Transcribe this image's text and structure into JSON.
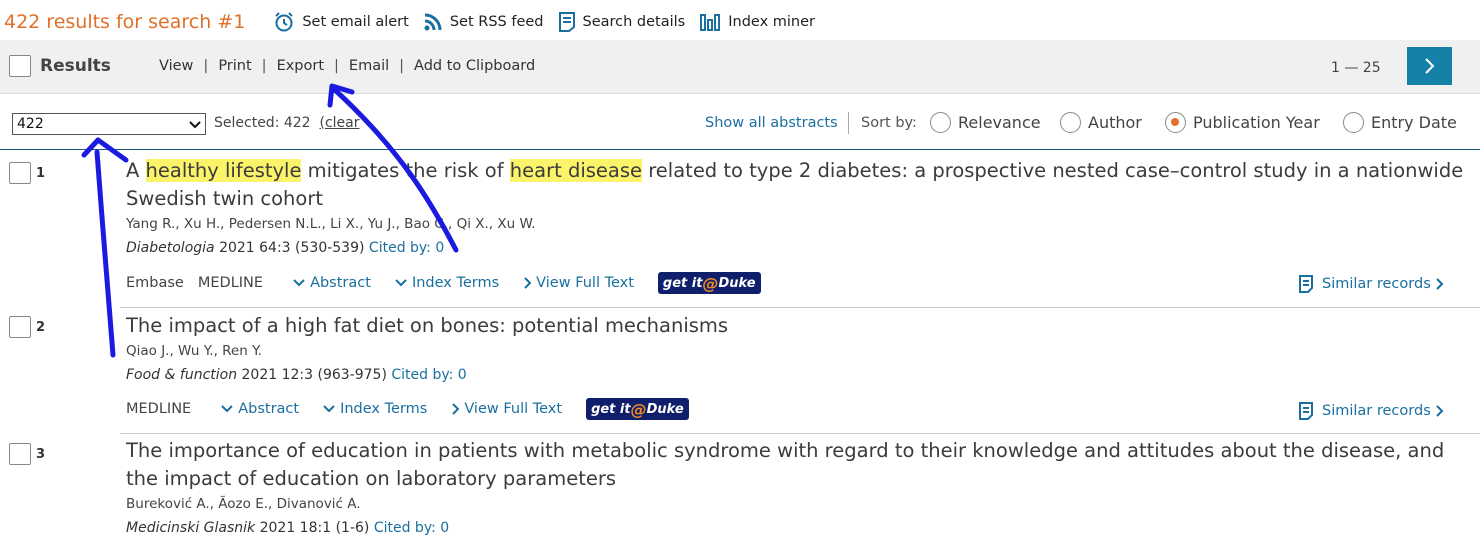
{
  "header": {
    "results_count": "422 results for search #1",
    "actions": [
      {
        "icon": "alarm-clock-icon",
        "label": "Set email alert"
      },
      {
        "icon": "rss-icon",
        "label": "Set RSS feed"
      },
      {
        "icon": "document-icon",
        "label": "Search details"
      },
      {
        "icon": "bar-chart-icon",
        "label": "Index miner"
      }
    ]
  },
  "results_bar": {
    "label": "Results",
    "actions": [
      "View",
      "Print",
      "Export",
      "Email",
      "Add to Clipboard"
    ],
    "paging": "1 — 25"
  },
  "controls": {
    "count_select_value": "422",
    "selected_label": "Selected:  422",
    "clear_label": "(clear",
    "show_abstracts": "Show all abstracts",
    "sort_by_label": "Sort by:",
    "sort_options": [
      {
        "label": "Relevance",
        "selected": false
      },
      {
        "label": "Author",
        "selected": false
      },
      {
        "label": "Publication Year",
        "selected": true
      },
      {
        "label": "Entry Date",
        "selected": false
      }
    ]
  },
  "records": [
    {
      "num": "1",
      "title_parts": [
        {
          "text": "A ",
          "hl": false
        },
        {
          "text": "healthy lifestyle",
          "hl": true
        },
        {
          "text": " mitigates the risk of ",
          "hl": false
        },
        {
          "text": "heart disease",
          "hl": true
        },
        {
          "text": " related to type 2 diabetes: a prospective nested case–control study in a nationwide Swedish twin cohort",
          "hl": false
        }
      ],
      "authors": "Yang R., Xu H., Pedersen N.L., Li X., Yu J., Bao C., Qi X., Xu W.",
      "journal": "Diabetologia",
      "citation": " 2021 64:3 (530-539) ",
      "cited_by": "Cited by: 0",
      "databases": [
        "Embase",
        "MEDLINE"
      ],
      "links": [
        "Abstract",
        "Index Terms",
        "View Full Text"
      ]
    },
    {
      "num": "2",
      "title_parts": [
        {
          "text": "The impact of a high fat diet on bones: potential mechanisms",
          "hl": false
        }
      ],
      "authors": "Qiao J., Wu Y., Ren Y.",
      "journal": "Food & function",
      "citation": " 2021 12:3 (963-975) ",
      "cited_by": "Cited by: 0",
      "databases": [
        "MEDLINE"
      ],
      "links": [
        "Abstract",
        "Index Terms",
        "View Full Text"
      ]
    },
    {
      "num": "3",
      "title_parts": [
        {
          "text": "The importance of education in patients with metabolic syndrome with regard to their knowledge and attitudes about the disease, and the impact of education on laboratory parameters",
          "hl": false
        }
      ],
      "authors": "Bureković A., Ãozo E., Divanović A.",
      "journal": "Medicinski Glasnik",
      "citation": " 2021 18:1 (1-6) ",
      "cited_by": "Cited by: 0",
      "databases": [],
      "links": []
    }
  ],
  "getit": {
    "prefix": "get it",
    "at": "@",
    "suffix": "Duke"
  },
  "similar_label": "Similar records",
  "colors": {
    "accent_orange": "#e07028",
    "link_blue": "#1a6fa0",
    "next_button": "#1580a8",
    "highlight": "#fbf46a",
    "annotation_ink": "#1a1ae0"
  }
}
